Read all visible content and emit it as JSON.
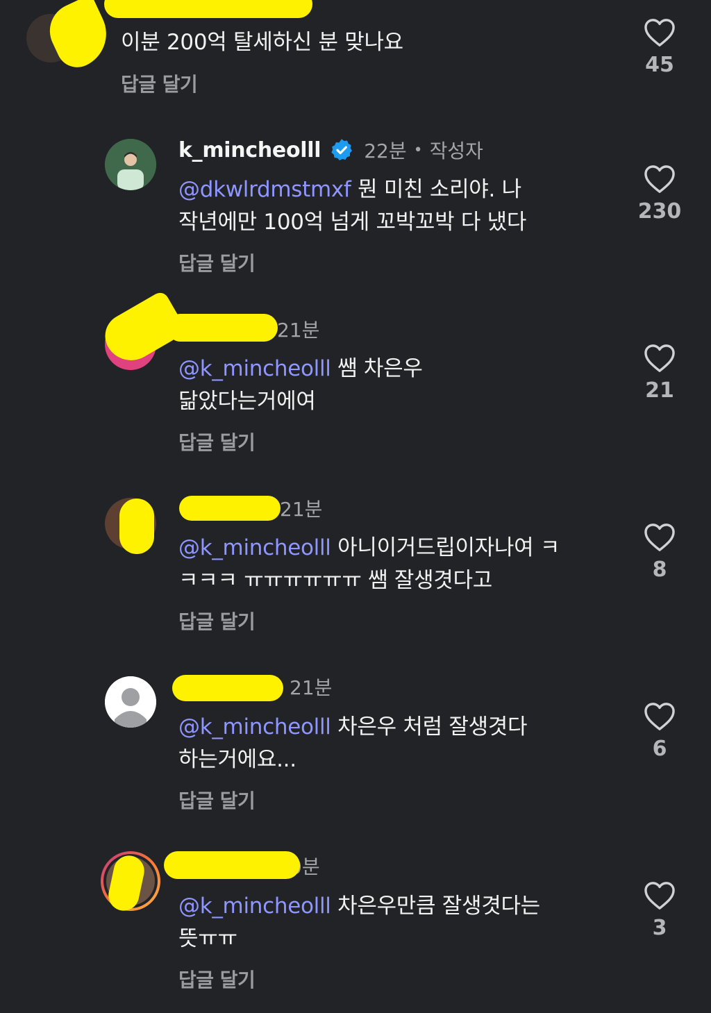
{
  "reply_label": "답글 달기",
  "comments": [
    {
      "username": "",
      "time": "",
      "text": "이분 200억 탈세하신 분 맞나요",
      "mention": "",
      "likes": "45"
    },
    {
      "username": "k_mincheolll",
      "time": "22분",
      "author_tag": "작성자",
      "mention": "@dkwlrdmstmxf",
      "text": " 뭔 미친 소리야. 나",
      "text2": "작년에만 100억 넘게 꼬박꼬박 다 냈다",
      "likes": "230"
    },
    {
      "username": "",
      "time": "21분",
      "mention": "@k_mincheolll",
      "text": " 쌤 차은우",
      "text2": "닮았다는거에여",
      "likes": "21"
    },
    {
      "username": "",
      "time": "21분",
      "mention": "@k_mincheolll",
      "text": " 아니이거드립이자나여 ㅋ",
      "text2": "ㅋㅋㅋ ㅠㅠㅠㅠㅠㅠ 쌤 잘생겻다고",
      "likes": "8"
    },
    {
      "username": "",
      "time": "21분",
      "mention": "@k_mincheolll",
      "text": " 차은우 처럼 잘생겻다",
      "text2": "하는거에요...",
      "likes": "6"
    },
    {
      "username": "",
      "time": "0분",
      "mention": "@k_mincheolll",
      "text": " 차은우만큼 잘생겻다는",
      "text2": "뜻ㅠㅠ",
      "likes": "3"
    }
  ],
  "colors": {
    "background": "#212326",
    "mention": "#8f96ff",
    "verified": "#1d9bf0",
    "redaction": "#fff200"
  },
  "icons": [
    "heart-icon",
    "verified-badge-icon",
    "threads-icon",
    "default-avatar-icon"
  ]
}
